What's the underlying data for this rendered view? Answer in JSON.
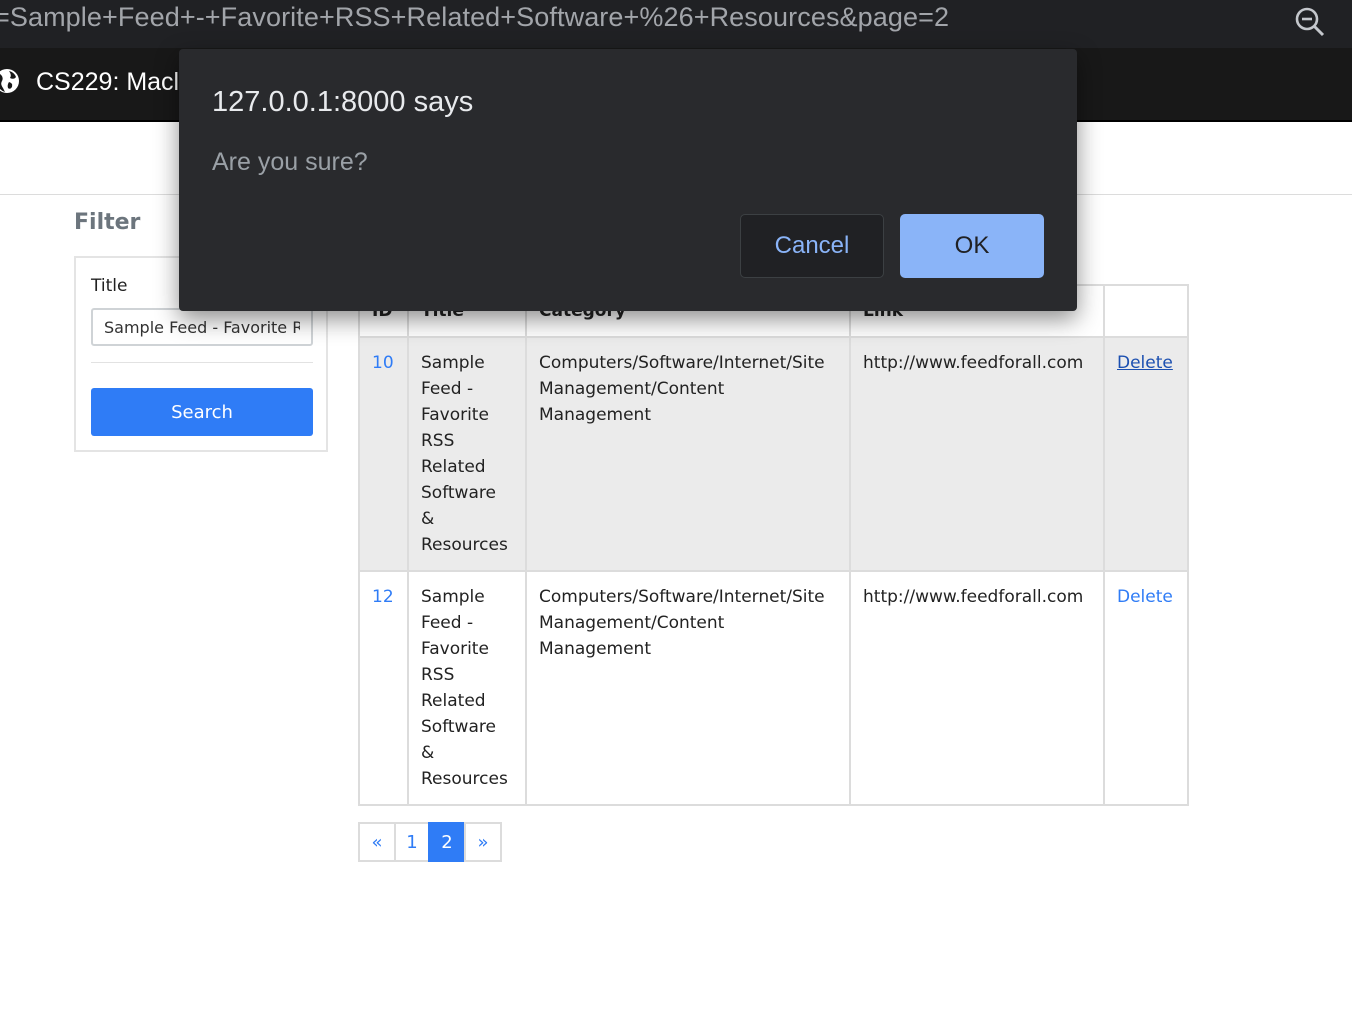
{
  "browser": {
    "url": "=Sample+Feed+-+Favorite+RSS+Related+Software+%26+Resources&page=2",
    "zoom_icon": "zoom-out-icon"
  },
  "navbar": {
    "brand": "CS229: Macl",
    "icon": "globe-icon"
  },
  "filter": {
    "heading": "Filter",
    "title_label": "Title",
    "title_value": "Sample Feed - Favorite RSS Related Software & Resources",
    "search_label": "Search"
  },
  "table": {
    "headers": {
      "id": "ID",
      "title": "Title",
      "category": "Category",
      "link": "Link",
      "action": ""
    },
    "rows": [
      {
        "id": "10",
        "title": "Sample Feed - Favorite RSS Related Software & Resources",
        "category": "Computers/Software/Internet/Site Management/Content Management",
        "link": "http://www.feedforall.com",
        "action": "Delete"
      },
      {
        "id": "12",
        "title": "Sample Feed - Favorite RSS Related Software & Resources",
        "category": "Computers/Software/Internet/Site Management/Content Management",
        "link": "http://www.feedforall.com",
        "action": "Delete"
      }
    ]
  },
  "pagination": {
    "prev": "«",
    "pages": [
      "1",
      "2"
    ],
    "current": "2",
    "next": "»"
  },
  "dialog": {
    "title": "127.0.0.1:8000 says",
    "message": "Are you sure?",
    "cancel_label": "Cancel",
    "ok_label": "OK"
  }
}
